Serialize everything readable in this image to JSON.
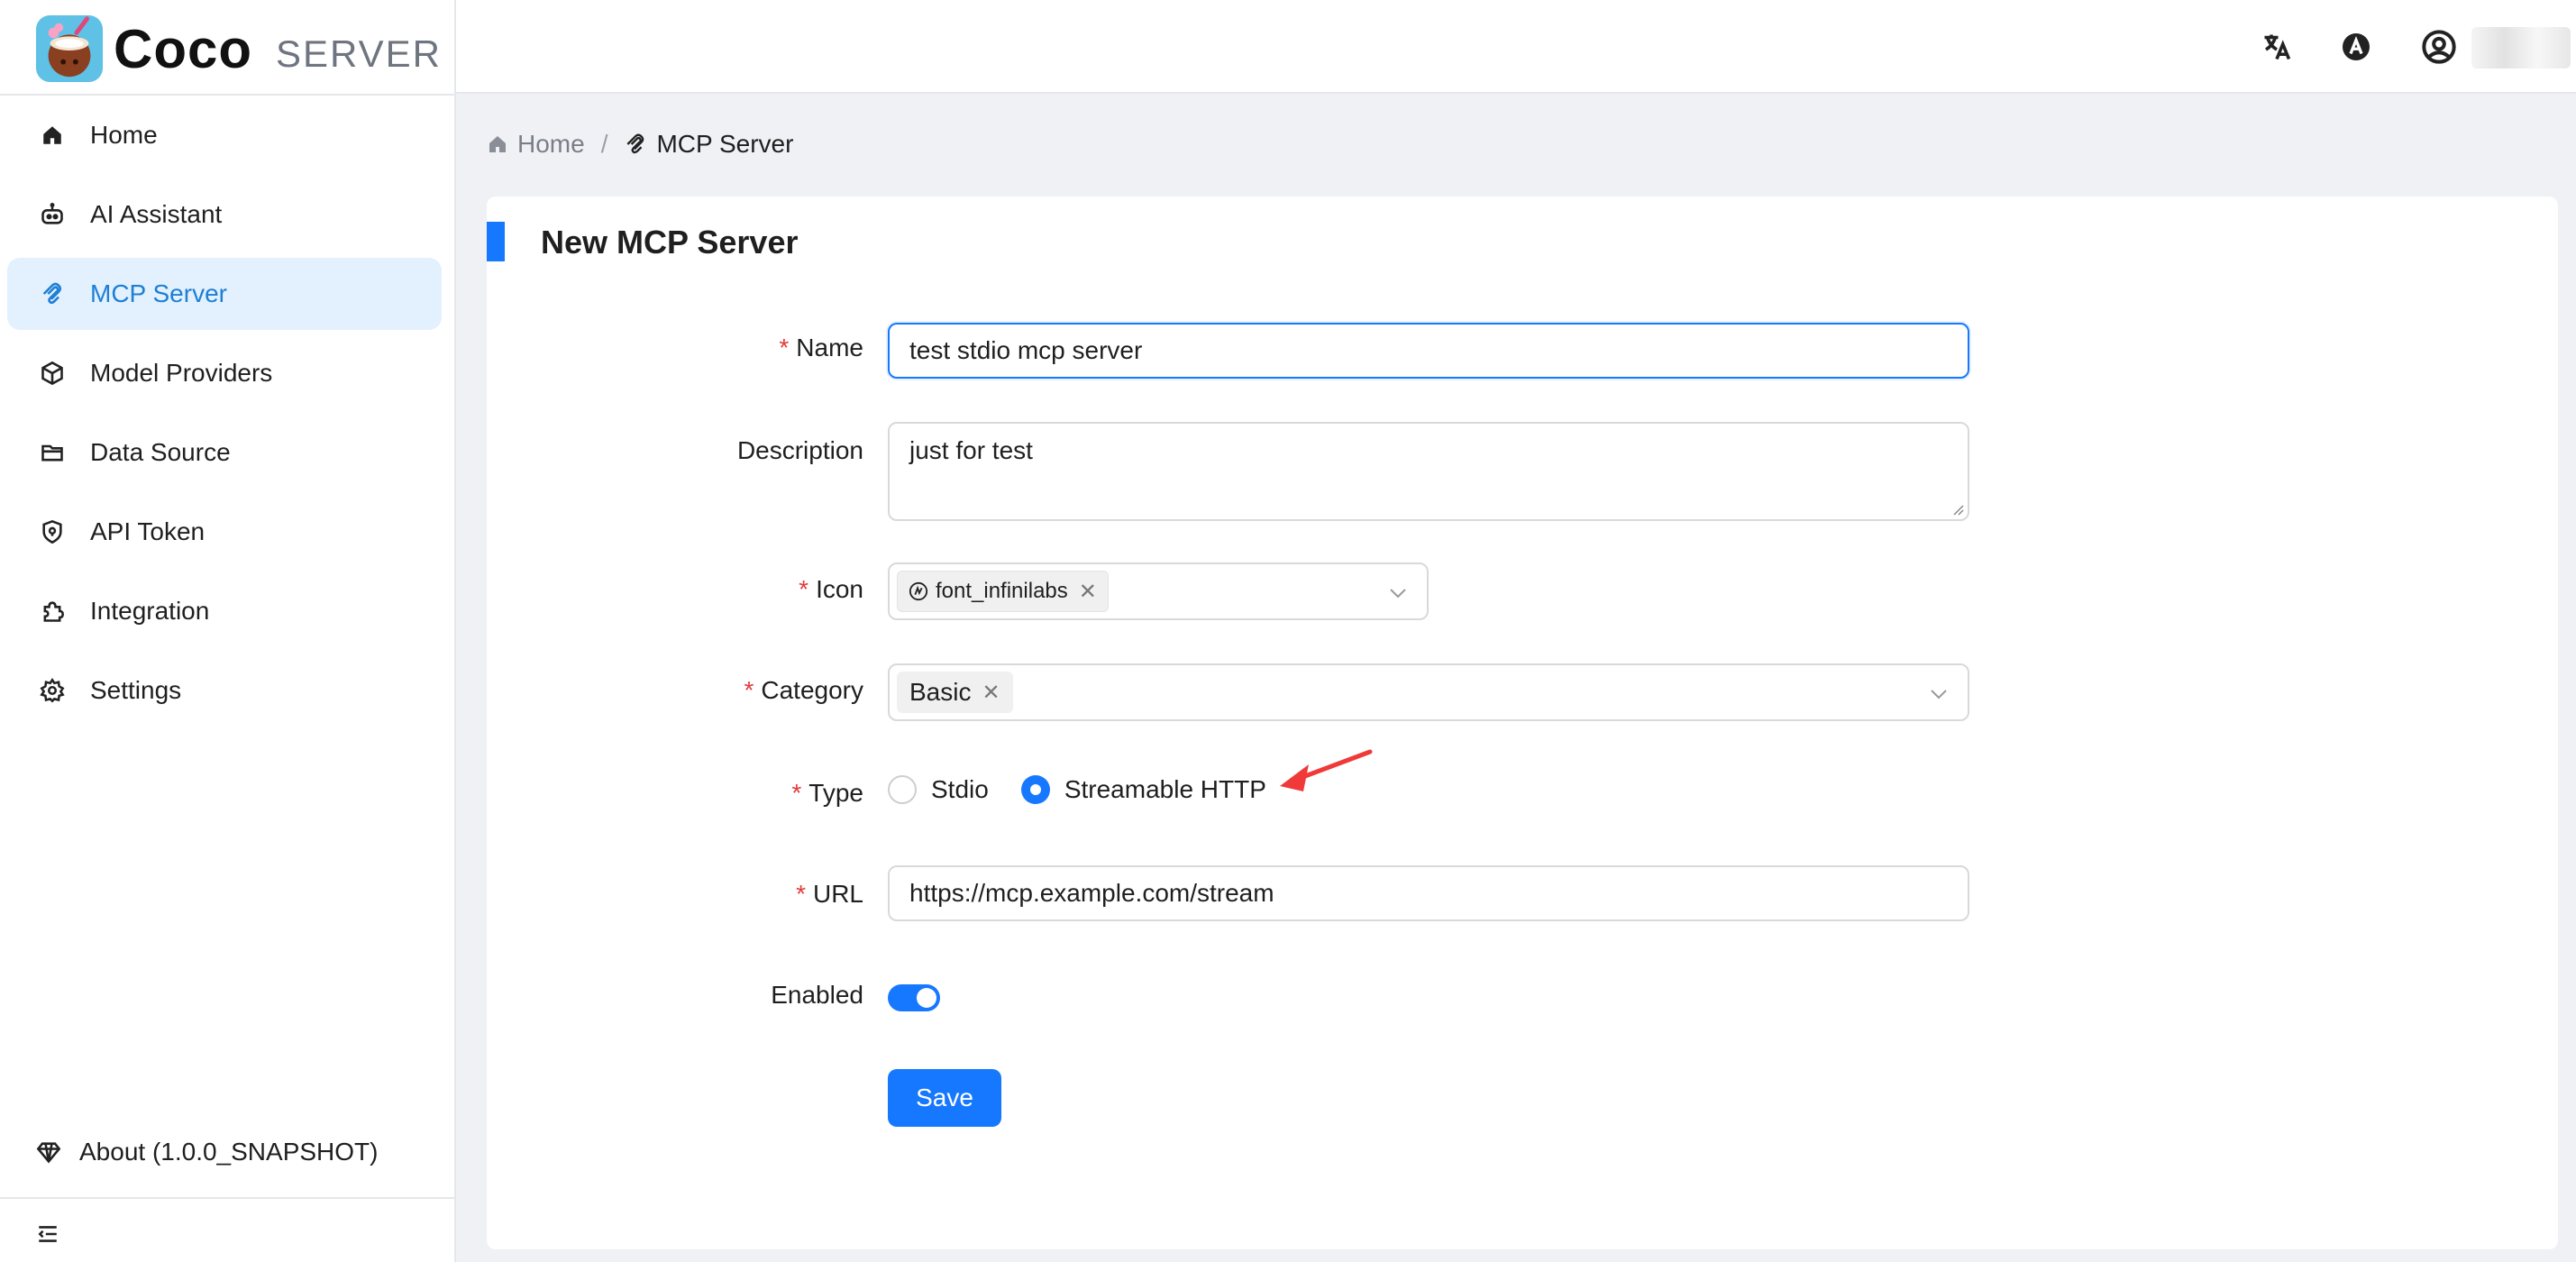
{
  "app": {
    "logo_text": "Coco",
    "logo_sub": "SERVER"
  },
  "sidebar": {
    "items": [
      {
        "label": "Home",
        "icon": "home-icon",
        "active": false
      },
      {
        "label": "AI Assistant",
        "icon": "robot-icon",
        "active": false
      },
      {
        "label": "MCP Server",
        "icon": "mcp-icon",
        "active": true
      },
      {
        "label": "Model Providers",
        "icon": "cube-icon",
        "active": false
      },
      {
        "label": "Data Source",
        "icon": "folder-icon",
        "active": false
      },
      {
        "label": "API Token",
        "icon": "shield-icon",
        "active": false
      },
      {
        "label": "Integration",
        "icon": "puzzle-icon",
        "active": false
      },
      {
        "label": "Settings",
        "icon": "gear-icon",
        "active": false
      }
    ],
    "about_label": "About (1.0.0_SNAPSHOT)"
  },
  "header": {
    "icons": [
      "translate-icon",
      "theme-icon",
      "user-icon"
    ]
  },
  "breadcrumb": {
    "home": "Home",
    "separator": "/",
    "current": "MCP Server"
  },
  "form": {
    "title": "New MCP Server",
    "name": {
      "label": "Name",
      "required": true,
      "value": "test stdio mcp server"
    },
    "description": {
      "label": "Description",
      "required": false,
      "value": "just for test"
    },
    "icon": {
      "label": "Icon",
      "required": true,
      "tag": "font_infinilabs"
    },
    "category": {
      "label": "Category",
      "required": true,
      "tag": "Basic"
    },
    "type": {
      "label": "Type",
      "required": true,
      "options": [
        "Stdio",
        "Streamable HTTP"
      ],
      "selected": "Streamable HTTP"
    },
    "url": {
      "label": "URL",
      "required": true,
      "value": "https://mcp.example.com/stream"
    },
    "enabled": {
      "label": "Enabled",
      "value": true
    },
    "save_label": "Save"
  },
  "colors": {
    "accent": "#1677ff",
    "active_menu_bg": "#e3f1fe",
    "active_menu_text": "#1d7fd6",
    "required": "#e23b3b",
    "annotation_arrow": "#f03a3a"
  }
}
